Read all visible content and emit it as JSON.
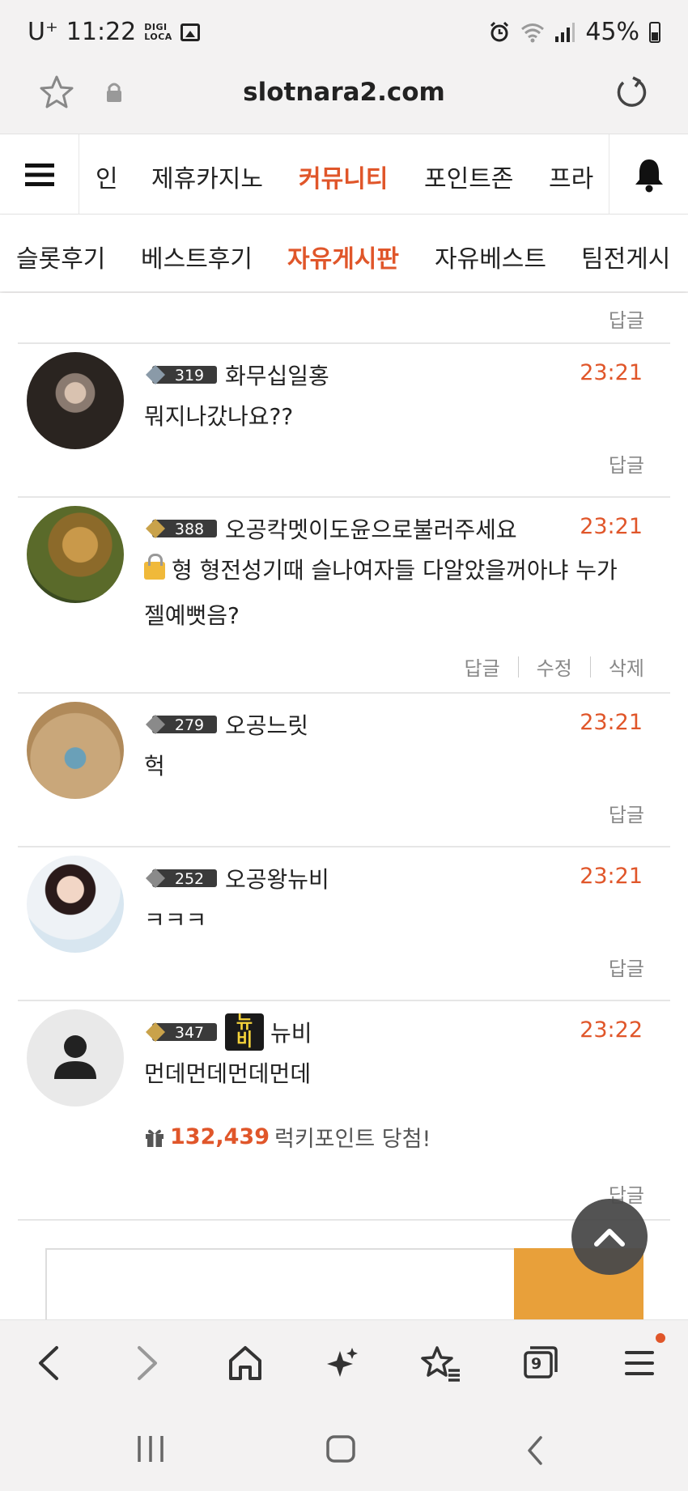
{
  "status_bar": {
    "carrier": "U⁺",
    "time": "11:22",
    "digi_line1": "DIGI",
    "digi_line2": "LOCA",
    "battery": "45%"
  },
  "url_bar": {
    "domain": "slotnara2.com"
  },
  "main_nav": {
    "items": [
      "인",
      "제휴카지노",
      "커뮤니티",
      "포인트존",
      "프라"
    ],
    "active": "커뮤니티"
  },
  "sub_nav": {
    "items": [
      "슬롯후기",
      "베스트후기",
      "자유게시판",
      "자유베스트",
      "팀전게시"
    ],
    "active": "자유게시판"
  },
  "top_reply_label": "답글",
  "comments": [
    {
      "level": "319",
      "nickname": "화무십일홍",
      "time": "23:21",
      "text": "뭐지나갔나요??",
      "actions": [
        "답글"
      ]
    },
    {
      "level": "388",
      "nickname": "오공칵멧이도윤으로불러주세요",
      "time": "23:21",
      "text_line1": "형 형전성기때 슬나여자들 다알았을꺼아냐 누가",
      "text_line2": "젤예뻣음?",
      "actions": [
        "답글",
        "수정",
        "삭제"
      ]
    },
    {
      "level": "279",
      "nickname": "오공느릿",
      "time": "23:21",
      "text": "헉",
      "actions": [
        "답글"
      ]
    },
    {
      "level": "252",
      "nickname": "오공왕뉴비",
      "time": "23:21",
      "text": "ㅋㅋㅋ",
      "actions": [
        "답글"
      ]
    },
    {
      "level": "347",
      "newbie_badge_line1": "뉴",
      "newbie_badge_line2": "비",
      "nickname": "뉴비",
      "time": "23:22",
      "text": "먼데먼데먼데먼데",
      "lucky_points": "132,439",
      "lucky_label": "럭키포인트 당첨!",
      "actions": [
        "답글"
      ]
    }
  ],
  "tabs_count": "9",
  "colors": {
    "accent": "#e0562a",
    "write_button": "#e8a03a",
    "scroll_top": "#4a4a4a"
  }
}
